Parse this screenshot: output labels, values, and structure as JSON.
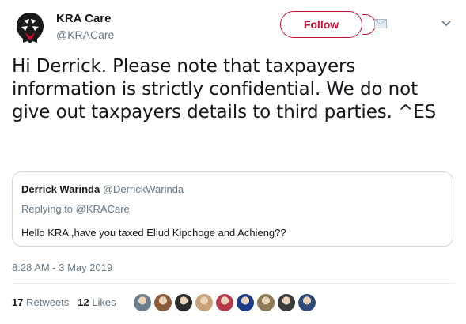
{
  "account": {
    "display_name": "KRA Care",
    "handle": "@KRACare"
  },
  "header": {
    "follow_label": "Follow"
  },
  "tweet": {
    "text": "Hi Derrick. Please note that taxpayers information is strictly confidential. We do not give out taxpayers details to third parties. ^ES",
    "timestamp": "8:28 AM - 3 May 2019"
  },
  "quoted_tweet": {
    "author_name": "Derrick Warinda",
    "author_handle": "@DerrickWarinda",
    "replying_prefix": "Replying to",
    "replying_to": "@KRACare",
    "text": "Hello KRA ,have you taxed Eliud Kipchoge and Achieng??"
  },
  "stats": {
    "retweets_count": "17",
    "retweets_label": "Retweets",
    "likes_count": "12",
    "likes_label": "Likes"
  },
  "likers": [
    {
      "name": "liker-1",
      "color": "#6b7d8a"
    },
    {
      "name": "liker-2",
      "color": "#8a5a3c"
    },
    {
      "name": "liker-3",
      "color": "#2b2b2b"
    },
    {
      "name": "liker-4",
      "color": "#c9a27a"
    },
    {
      "name": "liker-5",
      "color": "#b53a4a"
    },
    {
      "name": "liker-6",
      "color": "#1c3a8c"
    },
    {
      "name": "liker-7",
      "color": "#8c7a55"
    },
    {
      "name": "liker-8",
      "color": "#3a3a3a"
    },
    {
      "name": "liker-9",
      "color": "#2d4a7a"
    }
  ],
  "colors": {
    "brand_red": "#c8102e",
    "text_primary": "#14171a",
    "text_secondary": "#657786",
    "link": "#1da1f2"
  }
}
